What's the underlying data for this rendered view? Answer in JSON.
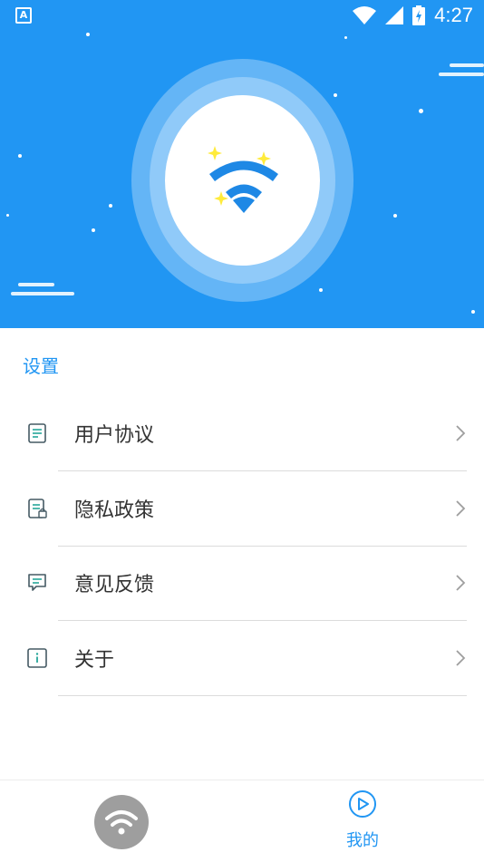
{
  "status_bar": {
    "app_icon_letter": "A",
    "time": "4:27"
  },
  "settings": {
    "title": "设置",
    "items": [
      {
        "label": "用户协议",
        "icon": "document-icon"
      },
      {
        "label": "隐私政策",
        "icon": "privacy-document-icon"
      },
      {
        "label": "意见反馈",
        "icon": "feedback-icon"
      },
      {
        "label": "关于",
        "icon": "info-icon"
      }
    ]
  },
  "bottom_nav": {
    "wifi_icon": "wifi-icon",
    "mine_label": "我的",
    "mine_icon": "play-circle-icon"
  },
  "colors": {
    "primary": "#2196F3",
    "text": "#333333",
    "accent_icon": "#26A69A",
    "sparkle": "#FFEB3B"
  }
}
